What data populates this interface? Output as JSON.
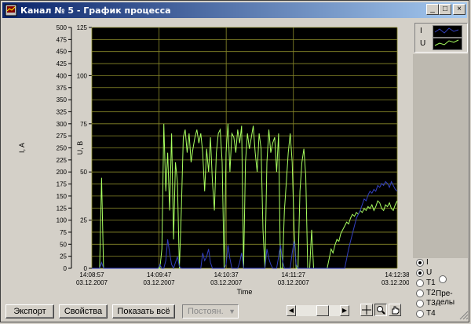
{
  "window": {
    "title": "Канал № 5 - График процесса",
    "controls": {
      "minimize": "_",
      "maximize": "□",
      "close": "×"
    }
  },
  "chart_data": {
    "type": "line",
    "xlabel": "Time",
    "ylabel_left": "I, A",
    "ylabel_right": "U, В",
    "y_left_lim": [
      0,
      500
    ],
    "y_left_ticks": [
      "500",
      "475",
      "450",
      "425",
      "400",
      "375",
      "350",
      "325",
      "300",
      "275",
      "250",
      "225",
      "200",
      "175",
      "150",
      "125",
      "100",
      "75",
      "50",
      "25",
      "0"
    ],
    "y_right_lim": [
      0,
      125
    ],
    "y_right_ticks": [
      "125",
      "100",
      "75",
      "50",
      "25",
      "0"
    ],
    "x_ticks": [
      {
        "time": "14:08:57",
        "date": "03.12.2007"
      },
      {
        "time": "14:09:47",
        "date": "03.12.2007"
      },
      {
        "time": "14:10:37",
        "date": "03.12.2007"
      },
      {
        "time": "14:11:27",
        "date": "03.12.2007"
      },
      {
        "time": "14:12:38",
        "date": "03.12.2007"
      }
    ],
    "background": "#000000",
    "grid": true,
    "series": [
      {
        "name": "I",
        "color": "#3340c0",
        "values": [
          0,
          0,
          0,
          0,
          0,
          3,
          0,
          0,
          0,
          0,
          0,
          0,
          0,
          0,
          0,
          0,
          0,
          0,
          0,
          0,
          0,
          0,
          0,
          0,
          0,
          0,
          0,
          0,
          0,
          0,
          0,
          0,
          0,
          0,
          0,
          2,
          0,
          0,
          4,
          15,
          8,
          2,
          0,
          3,
          6,
          1,
          0,
          0,
          0,
          0,
          0,
          0,
          0,
          0,
          0,
          0,
          0,
          8,
          4,
          6,
          10,
          3,
          0,
          0,
          0,
          0,
          0,
          0,
          0,
          2,
          12,
          5,
          0,
          0,
          0,
          0,
          3,
          8,
          0,
          0,
          0,
          0,
          0,
          0,
          0,
          0,
          0,
          0,
          0,
          0,
          10,
          5,
          2,
          0,
          0,
          0,
          6,
          12,
          4,
          0,
          0,
          0,
          0,
          8,
          14,
          2,
          0,
          0,
          0,
          0,
          0,
          0,
          0,
          0,
          0,
          0,
          0,
          0,
          0,
          0,
          0,
          0,
          0,
          0,
          0,
          0,
          0,
          0,
          0,
          0,
          0,
          5,
          10,
          14,
          18,
          22,
          26,
          28,
          30,
          33,
          36,
          35,
          38,
          40,
          39,
          41,
          40,
          43,
          42,
          44,
          43,
          45,
          44,
          42,
          45,
          43,
          41,
          40
        ]
      },
      {
        "name": "U",
        "color": "#a8ff60",
        "values": [
          0,
          0,
          0,
          0,
          0,
          47,
          0,
          0,
          0,
          0,
          0,
          0,
          0,
          0,
          0,
          0,
          0,
          0,
          0,
          0,
          0,
          0,
          0,
          0,
          0,
          0,
          0,
          0,
          0,
          0,
          0,
          0,
          0,
          0,
          0,
          0,
          10,
          75,
          40,
          60,
          30,
          70,
          15,
          55,
          45,
          0,
          30,
          68,
          72,
          60,
          70,
          55,
          62,
          68,
          72,
          65,
          70,
          60,
          40,
          62,
          50,
          68,
          45,
          30,
          60,
          70,
          72,
          55,
          0,
          60,
          75,
          50,
          70,
          68,
          60,
          72,
          65,
          74,
          0,
          55,
          70,
          62,
          68,
          74,
          60,
          50,
          70,
          62,
          20,
          0,
          55,
          72,
          60,
          65,
          68,
          50,
          70,
          0,
          0,
          30,
          45,
          60,
          70,
          55,
          20,
          0,
          0,
          40,
          55,
          62,
          48,
          0,
          0,
          20,
          0,
          0,
          0,
          0,
          0,
          0,
          0,
          0,
          5,
          10,
          8,
          12,
          15,
          14,
          18,
          20,
          22,
          24,
          23,
          26,
          28,
          27,
          29,
          28,
          30,
          29,
          31,
          30,
          32,
          31,
          33,
          30,
          32,
          35,
          34,
          31,
          30,
          33,
          32,
          34,
          31,
          30,
          33,
          35
        ]
      }
    ]
  },
  "legend": {
    "items": [
      "I",
      "U"
    ]
  },
  "channel_selector": {
    "options": [
      {
        "label": "I",
        "selected": true
      },
      {
        "label": "U",
        "selected": true
      },
      {
        "label": "T1",
        "selected": false
      },
      {
        "label": "T2",
        "selected": false
      },
      {
        "label": "T3",
        "selected": false
      },
      {
        "label": "T4",
        "selected": false
      }
    ],
    "limits_label": "Пре-\nделы"
  },
  "toolbar": {
    "export_label": "Экспорт",
    "properties_label": "Свойства",
    "show_all_label": "Показать всё",
    "mode_value": "Постоян."
  }
}
